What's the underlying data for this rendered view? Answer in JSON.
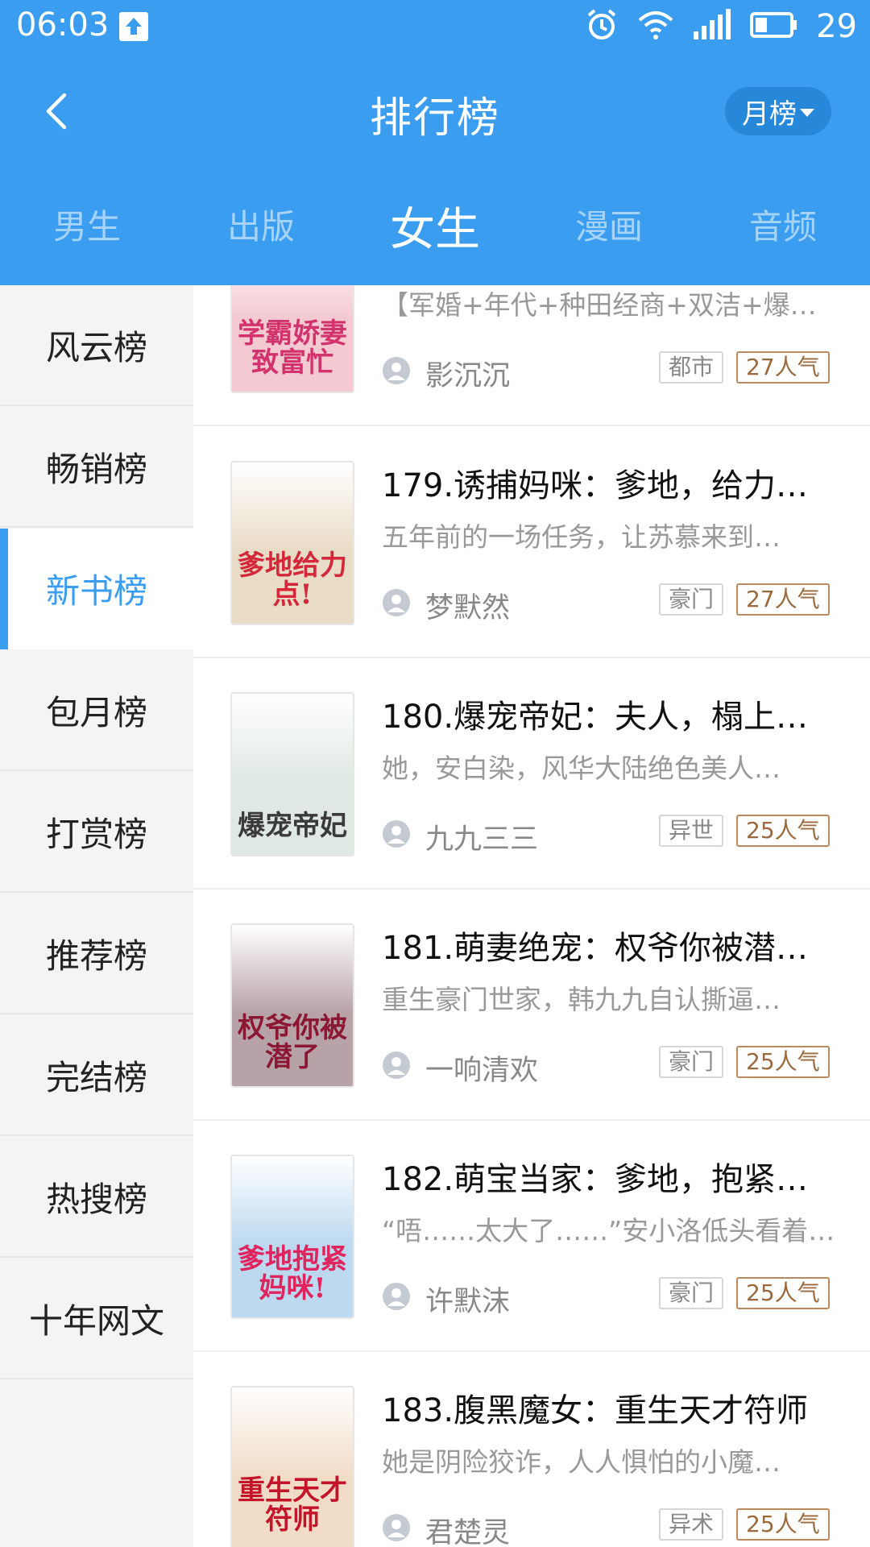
{
  "status_bar": {
    "time": "06:03",
    "battery": "29",
    "network": "4G"
  },
  "header": {
    "title": "排行榜",
    "period": "月榜"
  },
  "tabs": [
    {
      "label": "男生",
      "active": false
    },
    {
      "label": "出版",
      "active": false
    },
    {
      "label": "女生",
      "active": true
    },
    {
      "label": "漫画",
      "active": false
    },
    {
      "label": "音频",
      "active": false
    }
  ],
  "sidebar": [
    {
      "label": "风云榜",
      "active": false
    },
    {
      "label": "畅销榜",
      "active": false
    },
    {
      "label": "新书榜",
      "active": true
    },
    {
      "label": "包月榜",
      "active": false
    },
    {
      "label": "打赏榜",
      "active": false
    },
    {
      "label": "推荐榜",
      "active": false
    },
    {
      "label": "完结榜",
      "active": false
    },
    {
      "label": "热搜榜",
      "active": false
    },
    {
      "label": "十年网文",
      "active": false
    }
  ],
  "books": [
    {
      "title": "",
      "desc": "【军婚+年代+种田经商+双洁+爆…",
      "author": "影沉沉",
      "genre": "都市",
      "popularity": "27人气",
      "cover_text": "学霸娇妻致富忙",
      "cover_color": "#f4c9d2"
    },
    {
      "title": "179.诱捕妈咪：爹地，给力…",
      "desc": "五年前的一场任务，让苏慕来到…",
      "author": "梦默然",
      "genre": "豪门",
      "popularity": "27人气",
      "cover_text": "爹地给力点!",
      "cover_color": "#e9dcc6"
    },
    {
      "title": "180.爆宠帝妃：夫人，榻上…",
      "desc": "她，安白染，风华大陆绝色美人…",
      "author": "九九三三",
      "genre": "异世",
      "popularity": "25人气",
      "cover_text": "爆宠帝妃",
      "cover_color": "#dfe8e2"
    },
    {
      "title": "181.萌妻绝宠：权爷你被潜…",
      "desc": "重生豪门世家，韩九九自认撕逼…",
      "author": "一响清欢",
      "genre": "豪门",
      "popularity": "25人气",
      "cover_text": "权爷你被潜了",
      "cover_color": "#b7a2a8"
    },
    {
      "title": "182.萌宝当家：爹地，抱紧…",
      "desc": "“唔……太大了……”安小洛低头看着…",
      "author": "许默沫",
      "genre": "豪门",
      "popularity": "25人气",
      "cover_text": "爹地抱紧妈咪!",
      "cover_color": "#bcd9f0"
    },
    {
      "title": "183.腹黑魔女：重生天才符师",
      "desc": "她是阴险狡诈，人人惧怕的小魔…",
      "author": "君楚灵",
      "genre": "异术",
      "popularity": "25人气",
      "cover_text": "重生天才符师",
      "cover_color": "#f1dcc8"
    }
  ]
}
